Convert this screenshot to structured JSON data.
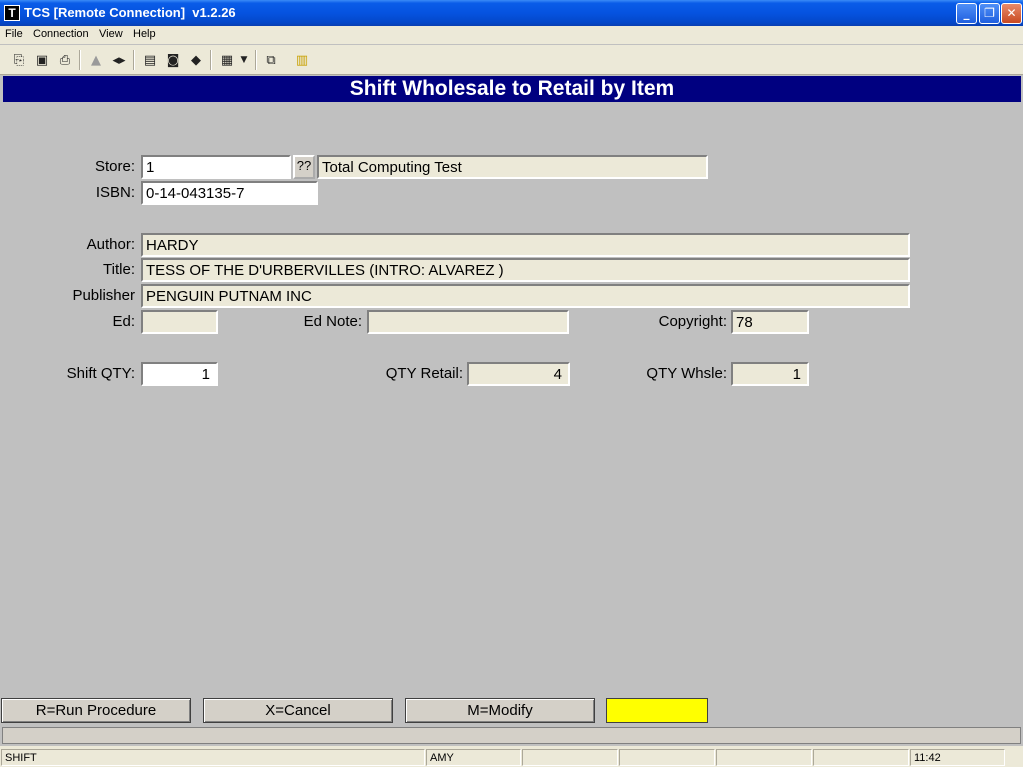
{
  "window": {
    "title": "TCS [Remote Connection]  v1.2.26",
    "app_icon": "T",
    "controls": {
      "minimize": "minimize-icon",
      "maximize": "restore-icon",
      "close": "close-icon"
    }
  },
  "menu": [
    "File",
    "Connection",
    "View",
    "Help"
  ],
  "toolbar": {
    "icons": [
      "copy-icon",
      "save-icon",
      "print-icon",
      "lock-icon",
      "audio-icon",
      "report-icon",
      "monitor-icon",
      "book-icon",
      "document-icon",
      "dropdown-arrow-icon",
      "network-icon",
      "chart-icon"
    ]
  },
  "header": {
    "title": "Shift Wholesale to Retail by Item"
  },
  "form": {
    "store_label": "Store:",
    "store_value": "1",
    "lookup_label": "??",
    "store_name": "Total Computing Test",
    "isbn_label": "ISBN:",
    "isbn_value": "0-14-043135-7",
    "author_label": "Author:",
    "author_value": "HARDY",
    "title_label": "Title:",
    "title_value": "TESS OF THE D'URBERVILLES (INTRO: ALVAREZ )",
    "publisher_label": "Publisher",
    "publisher_value": "PENGUIN PUTNAM INC",
    "ed_label": "Ed:",
    "ed_value": "",
    "ednote_label": "Ed Note:",
    "ednote_value": "",
    "copyright_label": "Copyright:",
    "copyright_value": "78",
    "shift_qty_label": "Shift QTY:",
    "shift_qty_value": "1",
    "qty_retail_label": "QTY Retail:",
    "qty_retail_value": "4",
    "qty_whsle_label": "QTY Whsle:",
    "qty_whsle_value": "1"
  },
  "buttons": {
    "run": "R=Run Procedure",
    "cancel": "X=Cancel",
    "modify": "M=Modify"
  },
  "status": {
    "mode": "SHIFT",
    "user": "AMY",
    "time": "11:42"
  },
  "colors": {
    "header": "#000080",
    "indicator": "#ffff00",
    "background": "#c0c0c0"
  }
}
